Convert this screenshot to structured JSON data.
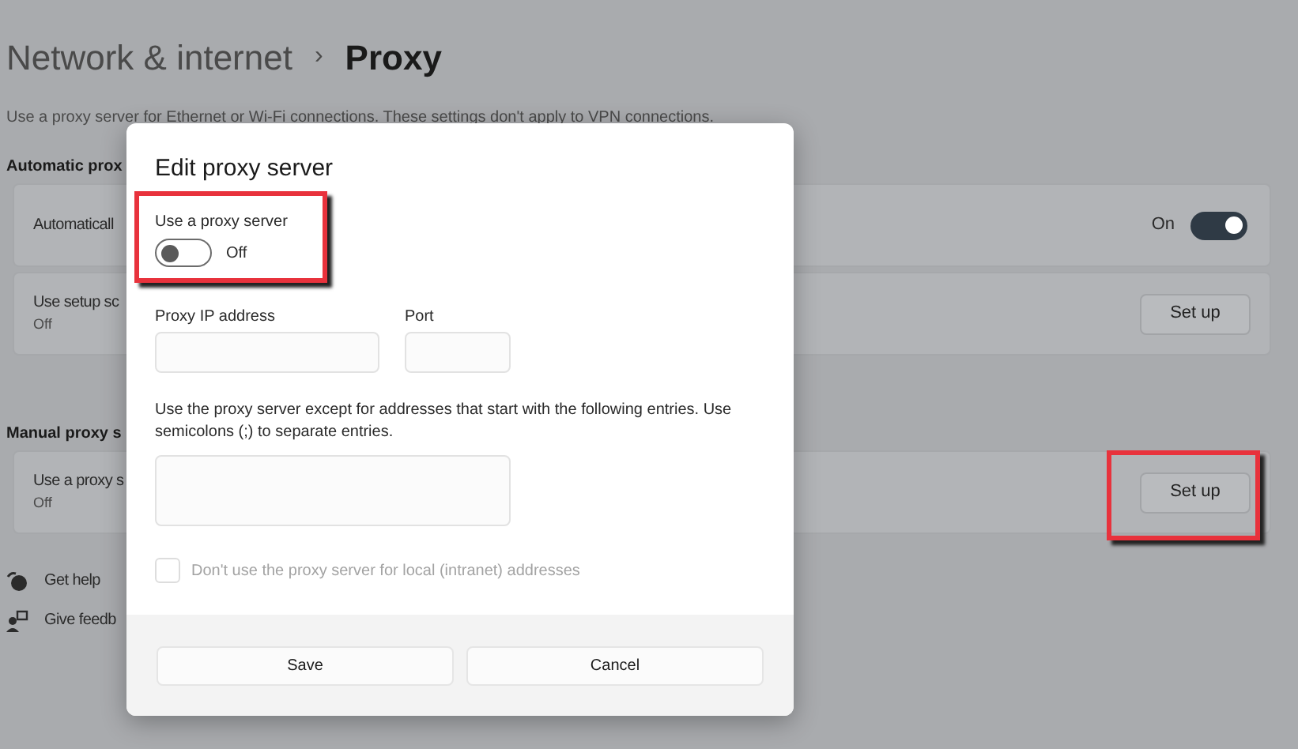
{
  "breadcrumb": {
    "parent": "Network & internet",
    "separator": "›",
    "current": "Proxy"
  },
  "description": "Use a proxy server for Ethernet or Wi-Fi connections. These settings don't apply to VPN connections.",
  "sections": [
    {
      "heading": "Automatic prox",
      "cards": [
        {
          "kind": "toggle",
          "title": "Automaticall",
          "state_label": "On",
          "on": true
        },
        {
          "kind": "button",
          "title": "Use setup sc",
          "subtitle": "Off",
          "button": "Set up"
        }
      ]
    },
    {
      "heading": "Manual proxy s",
      "cards": [
        {
          "kind": "button",
          "title": "Use a proxy s",
          "subtitle": "Off",
          "button": "Set up"
        }
      ]
    }
  ],
  "links": [
    {
      "kind": "help",
      "label": "Get help"
    },
    {
      "kind": "feedback",
      "label": "Give feedb"
    }
  ],
  "dialog": {
    "title": "Edit proxy server",
    "proxy_toggle": {
      "label": "Use a proxy server",
      "state_label": "Off",
      "on": false
    },
    "ip_field": {
      "label": "Proxy IP address"
    },
    "port_field": {
      "label": "Port"
    },
    "exceptions": {
      "label": "Use the proxy server except for addresses that start with the following entries. Use semicolons (;) to separate entries."
    },
    "local_checkbox": {
      "label": "Don't use the proxy server for local (intranet) addresses",
      "checked": false,
      "disabled": true
    },
    "buttons": [
      "Save",
      "Cancel"
    ]
  }
}
